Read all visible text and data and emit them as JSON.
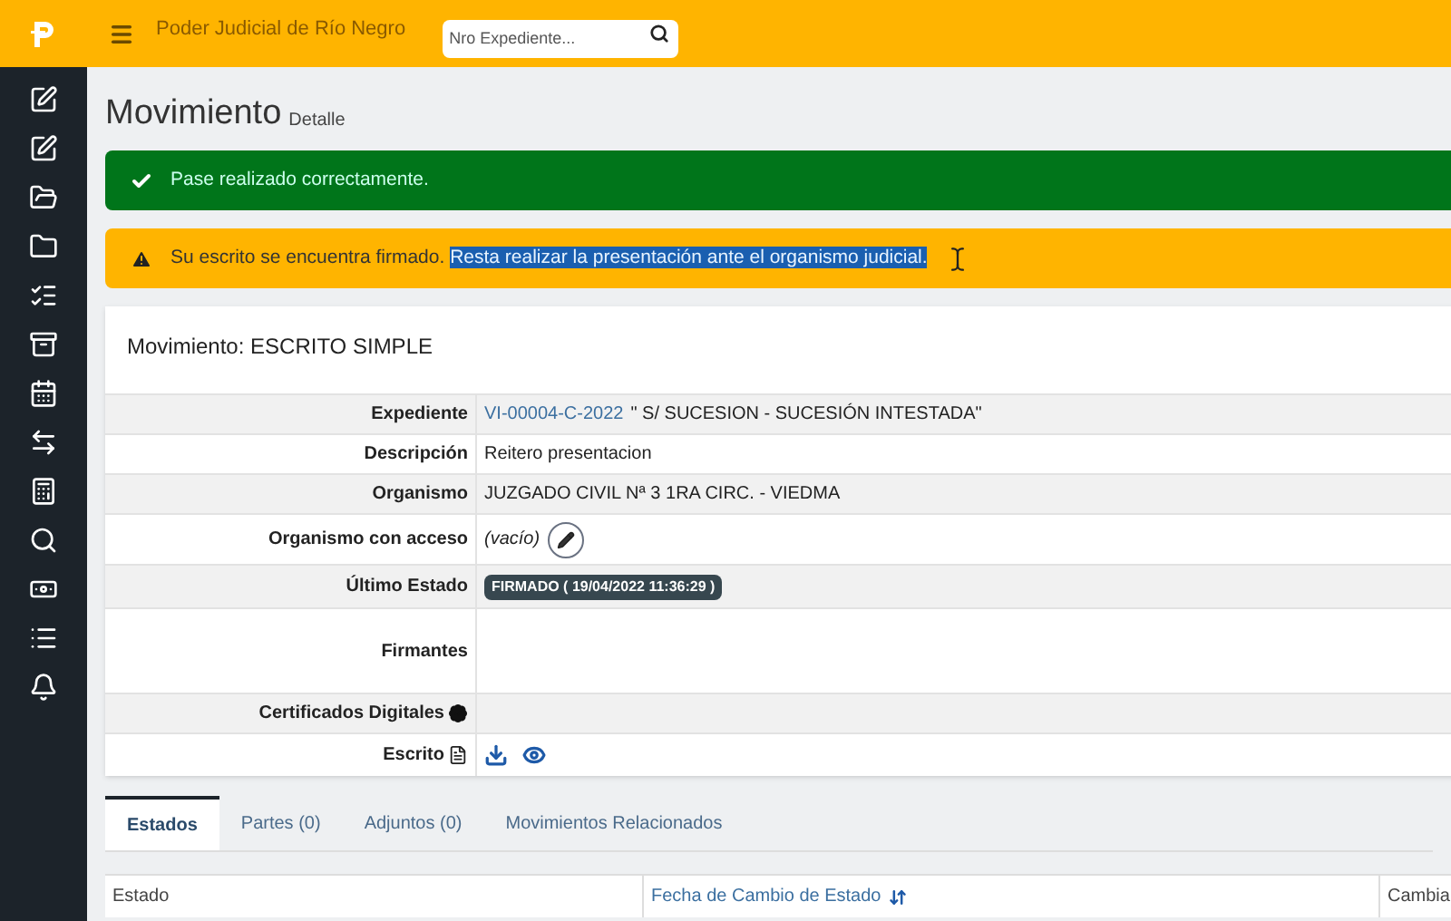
{
  "topbar": {
    "title": "Poder Judicial de Río Negro",
    "search": {
      "placeholder": "Nro Expediente..."
    }
  },
  "page": {
    "title": "Movimiento",
    "subtitle": "Detalle"
  },
  "alerts": [
    {
      "kind": "success",
      "text": "Pase realizado correctamente."
    },
    {
      "kind": "warning",
      "text": "Su escrito se encuentra firmado. ",
      "selected_text": "Resta realizar la presentación ante el organismo judicial."
    }
  ],
  "card": {
    "title": "Movimiento: ESCRITO SIMPLE",
    "rows": [
      {
        "label": "Expediente",
        "kind": "link",
        "link": "VI-00004-C-2022",
        "value": "\" S/ SUCESION - SUCESIÓN INTESTADA\""
      },
      {
        "label": "Descripción",
        "kind": "text",
        "value": "Reitero presentacion"
      },
      {
        "label": "Organismo",
        "kind": "text",
        "value": "JUZGADO CIVIL Nª 3 1RA CIRC. - VIEDMA"
      },
      {
        "label": "Organismo con acceso",
        "kind": "editable",
        "value": "(vacío)"
      },
      {
        "label": "Último Estado",
        "kind": "badge",
        "value": "FIRMADO ( 19/04/2022 11:36:29 )"
      },
      {
        "label": "Firmantes",
        "kind": "tall"
      },
      {
        "label": "Certificados Digitales",
        "kind": "certificate"
      },
      {
        "label": "Escrito",
        "kind": "file"
      }
    ]
  },
  "tabs": [
    {
      "label": "Estados",
      "selected": true
    },
    {
      "label": "Partes (0)",
      "selected": false
    },
    {
      "label": "Adjuntos (0)",
      "selected": false
    },
    {
      "label": "Movimientos Relacionados",
      "selected": false
    }
  ],
  "table": {
    "columns": [
      {
        "label": "Estado",
        "sortable": false
      },
      {
        "label": "Fecha de Cambio de Estado",
        "sortable": true
      },
      {
        "label": "Cambia",
        "sortable": false
      }
    ]
  }
}
